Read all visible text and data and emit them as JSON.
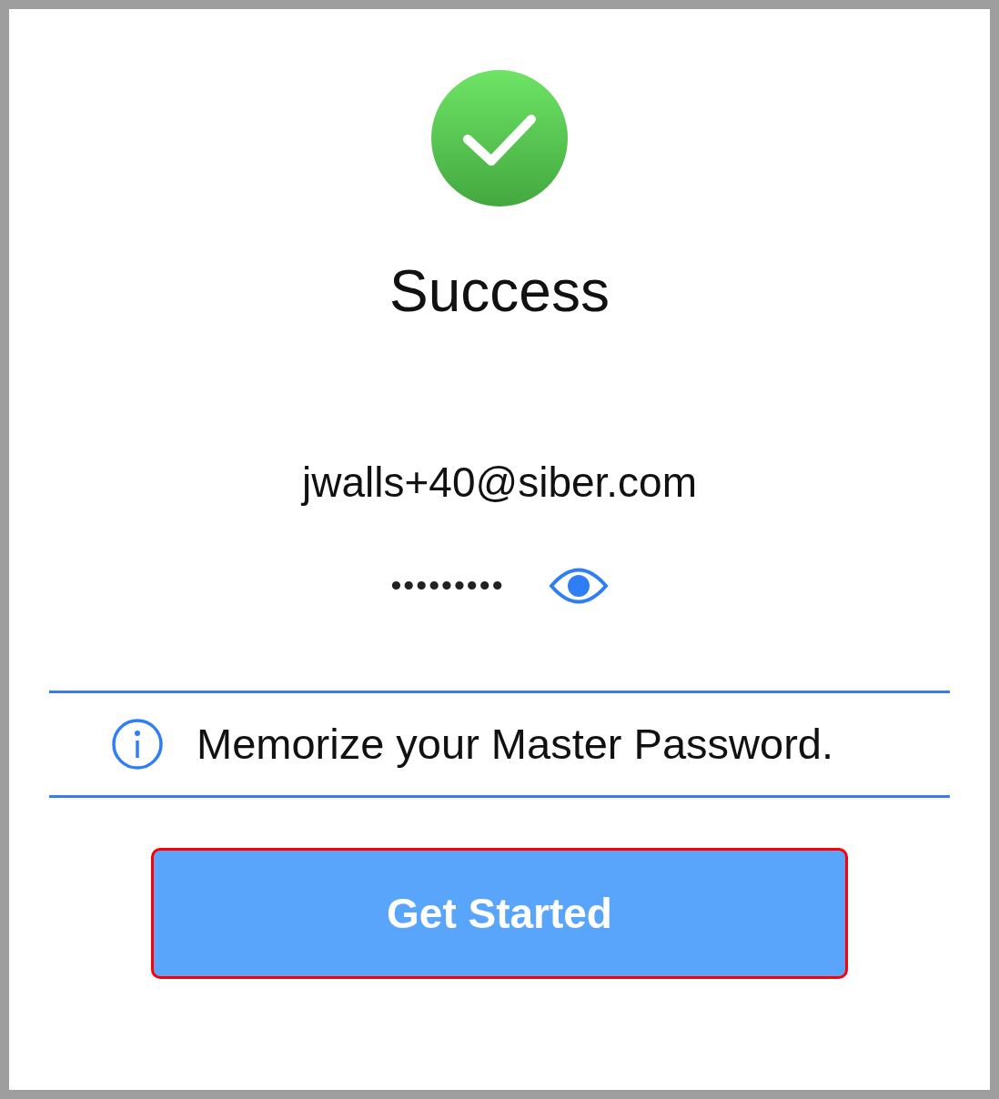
{
  "title": "Success",
  "account": {
    "email": "jwalls+40@siber.com",
    "password": "•••••••••",
    "password_visible": false
  },
  "notice": "Memorize your Master Password.",
  "button": {
    "label": "Get Started",
    "highlighted": true
  }
}
